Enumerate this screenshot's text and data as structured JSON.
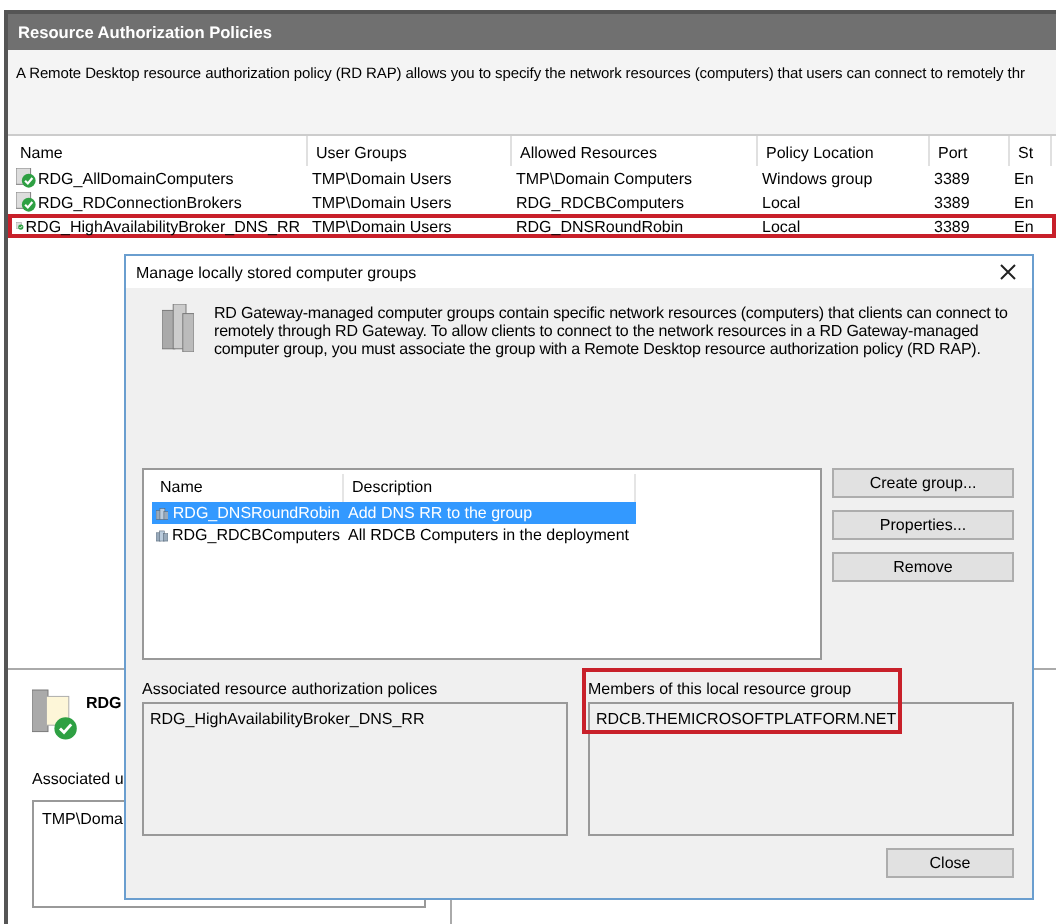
{
  "window": {
    "title": "Resource Authorization Policies"
  },
  "description": "A Remote Desktop resource authorization policy (RD RAP) allows you to specify the network resources (computers) that users can connect to remotely thr",
  "policies": {
    "columns": [
      "Name",
      "User Groups",
      "Allowed Resources",
      "Policy Location",
      "Port",
      "St"
    ],
    "rows": [
      {
        "cells": [
          "RDG_AllDomainComputers",
          "TMP\\Domain Users",
          "TMP\\Domain Computers",
          "Windows group",
          "3389",
          "En"
        ],
        "highlighted": false
      },
      {
        "cells": [
          "RDG_RDConnectionBrokers",
          "TMP\\Domain Users",
          "RDG_RDCBComputers",
          "Local",
          "3389",
          "En"
        ],
        "highlighted": false
      },
      {
        "cells": [
          "RDG_HighAvailabilityBroker_DNS_RR",
          "TMP\\Domain Users",
          "RDG_DNSRoundRobin",
          "Local",
          "3389",
          "En"
        ],
        "highlighted": true
      }
    ]
  },
  "details": {
    "name": "RDG",
    "associated_label": "Associated u",
    "user_groups": [
      "TMP\\Doma"
    ]
  },
  "dialog": {
    "title": "Manage locally stored computer groups",
    "message": "RD Gateway-managed computer groups contain specific network resources (computers) that clients can connect to remotely through RD Gateway. To allow clients to connect to the network resources in a RD Gateway-managed computer group, you must associate the group with a Remote Desktop resource authorization policy (RD RAP).",
    "groups": {
      "columns": [
        "Name",
        "Description"
      ],
      "rows": [
        {
          "name": "RDG_DNSRoundRobin",
          "description": "Add DNS RR to the group",
          "selected": true
        },
        {
          "name": "RDG_RDCBComputers",
          "description": "All RDCB Computers in the deployment",
          "selected": false
        }
      ]
    },
    "buttons": [
      "Create group...",
      "Properties...",
      "Remove"
    ],
    "associated_label": "Associated resource authorization polices",
    "associated_items": [
      "RDG_HighAvailabilityBroker_DNS_RR"
    ],
    "members_label": "Members of this local resource group",
    "members": [
      "RDCB.THEMICROSOFTPLATFORM.NET"
    ],
    "members_highlighted": true,
    "close_button": "Close"
  }
}
